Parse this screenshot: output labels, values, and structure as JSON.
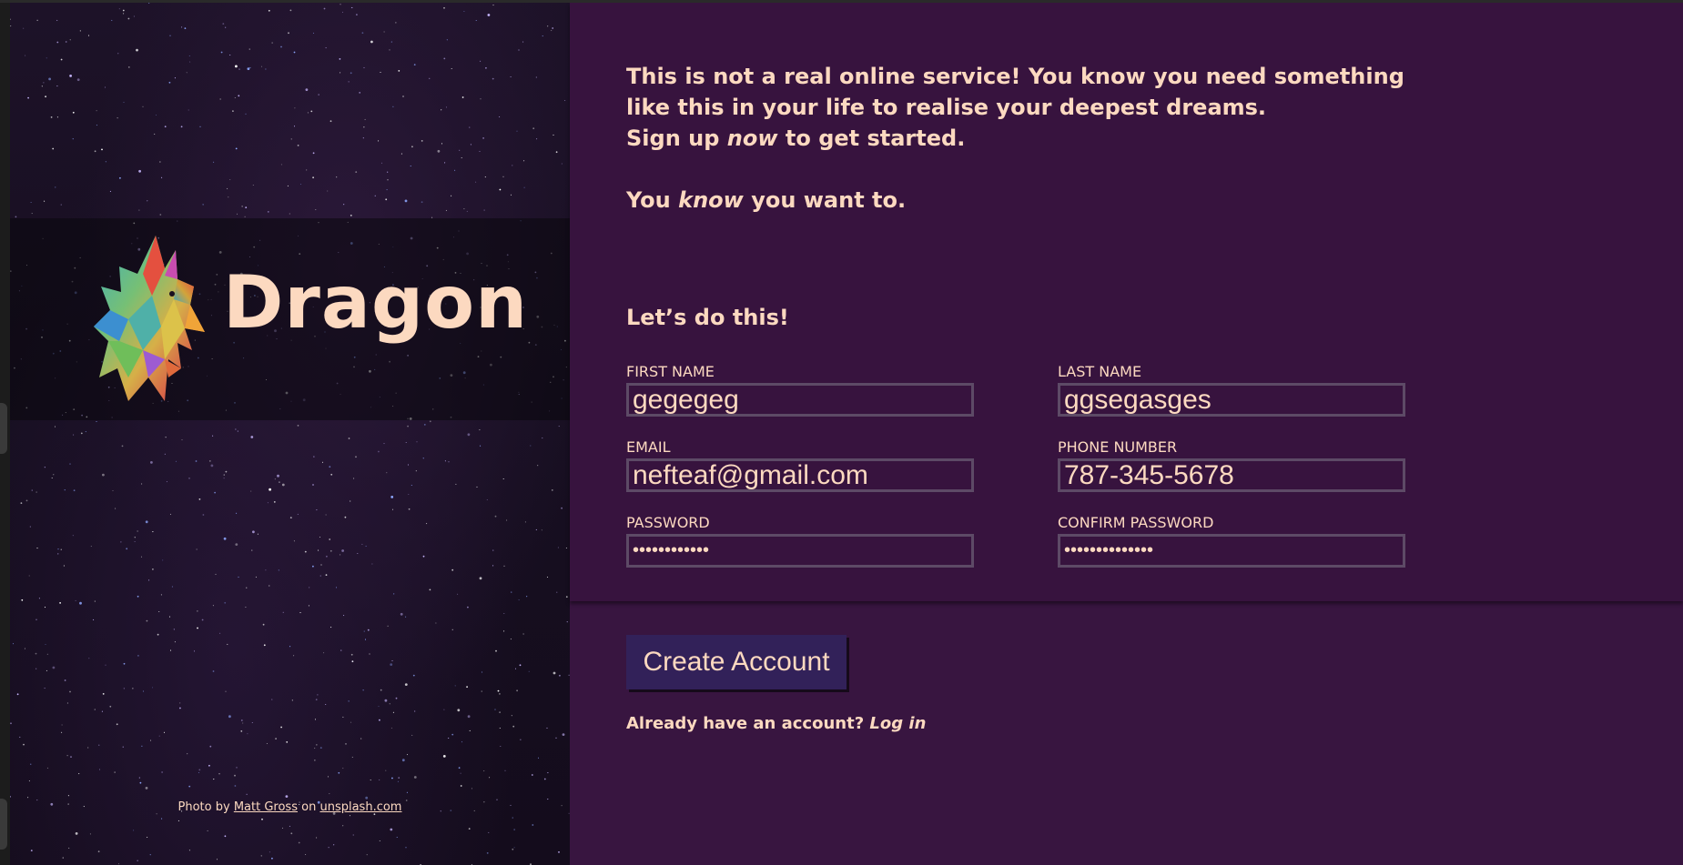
{
  "hero": {
    "brand_name": "Dragon",
    "credit": {
      "prefix": "Photo by",
      "author": "Matt Gross",
      "middle": "on",
      "site": "unsplash.com"
    }
  },
  "intro": {
    "line1": "This is not a real online service! You know you need something",
    "line2": "like this in your life to realise your deepest dreams.",
    "line3_before": "Sign up",
    "line3_em": "now",
    "line3_after": "to get started.",
    "line4_before": "You",
    "line4_em": "know",
    "line4_after": "you want to."
  },
  "form": {
    "heading": "Let’s do this!",
    "first_name": {
      "label": "FIRST NAME",
      "value": "gegegeg"
    },
    "last_name": {
      "label": "LAST NAME",
      "value": "ggsegasges"
    },
    "email": {
      "label": "EMAIL",
      "value": "nefteaf@gmail.com"
    },
    "phone": {
      "label": "PHONE NUMBER",
      "value": "787-345-5678"
    },
    "password": {
      "label": "PASSWORD",
      "value": "••••••••••••"
    },
    "confirm_password": {
      "label": "CONFIRM PASSWORD",
      "value": "••••••••••••••"
    },
    "submit_label": "Create Account",
    "login_prompt": "Already have an account?",
    "login_link": "Log in"
  },
  "colors": {
    "panel_bg": "#381540",
    "text": "#fcd9c0",
    "button_bg": "#322159",
    "input_border": "#5d4a66"
  }
}
